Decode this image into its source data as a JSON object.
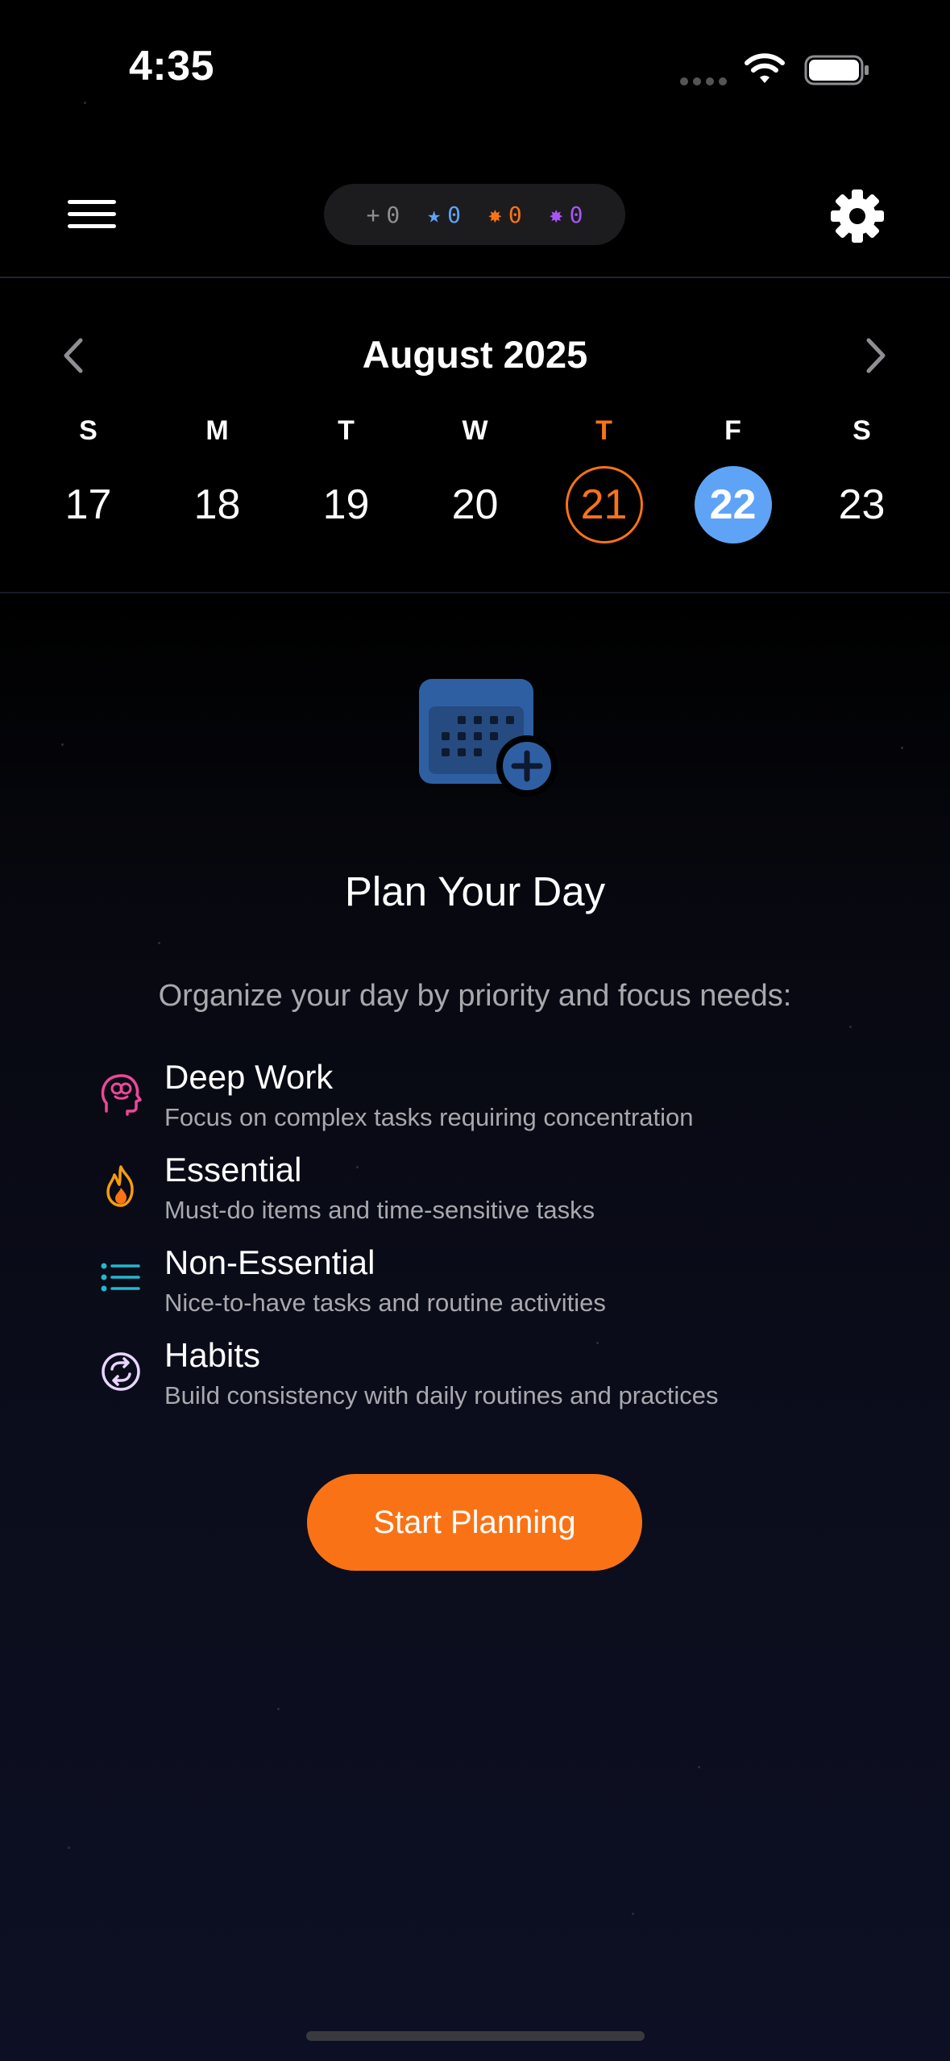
{
  "status_bar": {
    "time": "4:35"
  },
  "header": {
    "counters": [
      {
        "icon": "plus",
        "symbol": "+",
        "value": "0",
        "color": "#8e8e93"
      },
      {
        "icon": "star",
        "symbol": "★",
        "value": "0",
        "color": "#5fa3f7"
      },
      {
        "icon": "flame",
        "symbol": "✸",
        "value": "0",
        "color": "#f97316"
      },
      {
        "icon": "sparkle",
        "symbol": "✸",
        "value": "0",
        "color": "#a855f7"
      }
    ]
  },
  "calendar": {
    "month": "August 2025",
    "days": [
      {
        "dow": "S",
        "date": "17"
      },
      {
        "dow": "M",
        "date": "18"
      },
      {
        "dow": "T",
        "date": "19"
      },
      {
        "dow": "W",
        "date": "20"
      },
      {
        "dow": "T",
        "date": "21",
        "state": "today"
      },
      {
        "dow": "F",
        "date": "22",
        "state": "selected"
      },
      {
        "dow": "S",
        "date": "23"
      }
    ]
  },
  "empty_state": {
    "title": "Plan Your Day",
    "subtitle": "Organize your day by priority and focus needs:",
    "categories": [
      {
        "icon": "brain-head-icon",
        "title": "Deep Work",
        "description": "Focus on complex tasks requiring concentration",
        "color": "#ec4899"
      },
      {
        "icon": "flame-icon",
        "title": "Essential",
        "description": "Must-do items and time-sensitive tasks",
        "color": "#f59e0b"
      },
      {
        "icon": "list-icon",
        "title": "Non-Essential",
        "description": "Nice-to-have tasks and routine activities",
        "color": "#22b8cf"
      },
      {
        "icon": "repeat-circle-icon",
        "title": "Habits",
        "description": "Build consistency with daily routines and practices",
        "color": "#e9d5ff"
      }
    ],
    "cta_label": "Start Planning"
  },
  "colors": {
    "accent": "#f97316",
    "selected": "#5fa3f7",
    "icon_blue": "#2f5fa3"
  }
}
